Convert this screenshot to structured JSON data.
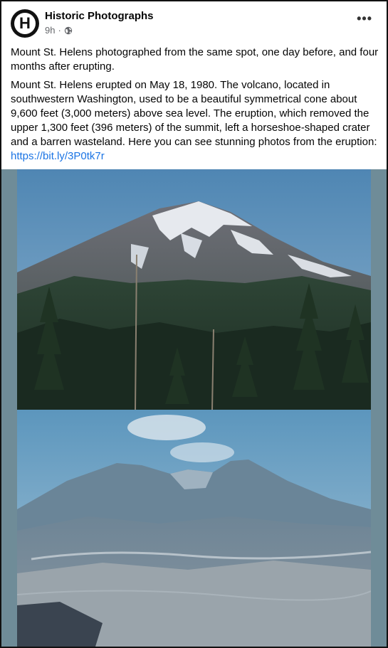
{
  "post": {
    "page_name": "Historic Photographs",
    "time": "9h",
    "visibility_icon": "globe-icon",
    "more_icon": "more-options-icon",
    "headline": "Mount St. Helens photographed from the same spot, one day before, and four months after erupting.",
    "body": "Mount St. Helens erupted on May 18, 1980. The volcano, located in southwestern Washington, used to be a beautiful symmetrical cone about 9,600 feet (3,000 meters) above sea level. The eruption, which removed the upper 1,300 feet (396 meters) of the summit, left a horseshoe-shaped crater and a barren wasteland. Here you can see stunning photos from the eruption:",
    "link": "https://bit.ly/3P0tk7r"
  },
  "avatar": {
    "letter": "H"
  },
  "colors": {
    "link": "#1b74e4",
    "meta": "#65676b",
    "text": "#050505"
  }
}
